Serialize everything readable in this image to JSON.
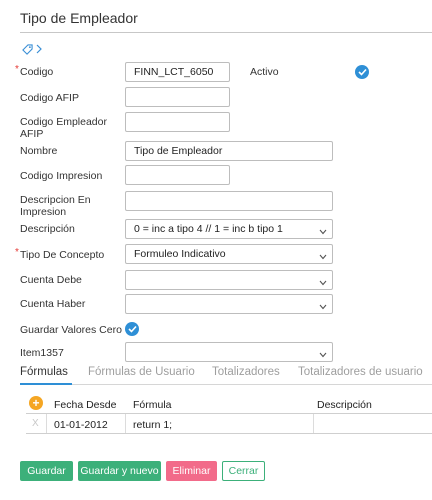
{
  "page": {
    "title": "Tipo de Empleador"
  },
  "form": {
    "codigo": {
      "label": "Codigo",
      "value": "FINN_LCT_6050",
      "required": true
    },
    "activo": {
      "label": "Activo",
      "checked": true
    },
    "codigo_afip": {
      "label": "Codigo AFIP",
      "value": ""
    },
    "codigo_empleador_afip": {
      "label": "Codigo Empleador AFIP",
      "value": ""
    },
    "nombre": {
      "label": "Nombre",
      "value": "Tipo de Empleador"
    },
    "codigo_impresion": {
      "label": "Codigo Impresion",
      "value": ""
    },
    "descripcion_impresion": {
      "label": "Descripcion En Impresion",
      "value": ""
    },
    "descripcion": {
      "label": "Descripción",
      "value": "0 = inc a tipo 4 // 1 = inc b tipo 1"
    },
    "tipo_concepto": {
      "label": "Tipo De Concepto",
      "value": "Formuleo Indicativo",
      "required": true
    },
    "cuenta_debe": {
      "label": "Cuenta Debe",
      "value": ""
    },
    "cuenta_haber": {
      "label": "Cuenta Haber",
      "value": ""
    },
    "guardar_valores_cero": {
      "label": "Guardar Valores Cero",
      "checked": true
    },
    "item1357": {
      "label": "Item1357",
      "value": ""
    }
  },
  "tabs": [
    {
      "label": "Fórmulas",
      "active": true
    },
    {
      "label": "Fórmulas de Usuario",
      "active": false
    },
    {
      "label": "Totalizadores",
      "active": false
    },
    {
      "label": "Totalizadores de usuario",
      "active": false
    }
  ],
  "grid": {
    "columns": [
      "Fecha Desde",
      "Fórmula",
      "Descripción"
    ],
    "rows": [
      {
        "delete_glyph": "X",
        "fecha_desde": "01-01-2012",
        "formula": "return 1;",
        "descripcion": ""
      }
    ]
  },
  "buttons": {
    "guardar": "Guardar",
    "guardar_y_nuevo": "Guardar y nuevo",
    "eliminar": "Eliminar",
    "cerrar": "Cerrar"
  },
  "colors": {
    "accent_blue": "#2e8fd6",
    "primary_green": "#3cb07a",
    "danger_pink": "#f26b8a",
    "required_red": "#e53935",
    "add_orange": "#f5a623"
  },
  "icons": {
    "nav": [
      "tag-icon",
      "chevron-right-icon"
    ],
    "check": "check-circle-icon",
    "select": "chevron-down-icon",
    "add": "plus-circle-icon"
  }
}
